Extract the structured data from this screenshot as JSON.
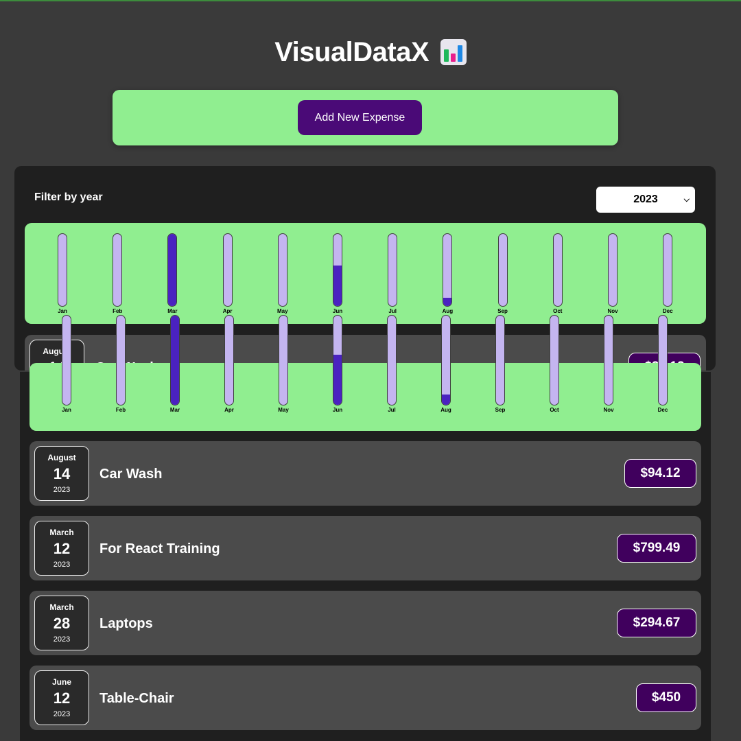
{
  "app": {
    "title": "VisualDataX"
  },
  "new_expense": {
    "add_label": "Add New Expense"
  },
  "filter": {
    "label": "Filter by year",
    "selected_year": "2023"
  },
  "chart_data": {
    "type": "bar",
    "categories": [
      "Jan",
      "Feb",
      "Mar",
      "Apr",
      "May",
      "Jun",
      "Jul",
      "Aug",
      "Sep",
      "Oct",
      "Nov",
      "Dec"
    ],
    "values": [
      0,
      0,
      799.49,
      0,
      0,
      450,
      0,
      94.12,
      0,
      0,
      0,
      0
    ],
    "ylim": [
      0,
      799.49
    ]
  },
  "expenses": [
    {
      "month": "August",
      "day": "14",
      "year": "2023",
      "title": "Car Wash",
      "amount": "$94.12"
    },
    {
      "month": "March",
      "day": "12",
      "year": "2023",
      "title": "For React Training",
      "amount": "$799.49"
    },
    {
      "month": "March",
      "day": "28",
      "year": "2023",
      "title": "Laptops",
      "amount": "$294.67"
    },
    {
      "month": "June",
      "day": "12",
      "year": "2023",
      "title": "Table-Chair",
      "amount": "$450"
    }
  ],
  "colors": {
    "page_bg": "#3a3a3a",
    "card_bg": "#1f1f1f",
    "chart_bg": "#90ee90",
    "bar_track": "#c4b5f0",
    "bar_fill": "#4a22c0",
    "button_bg": "#4a0a77",
    "price_bg": "#40005d"
  }
}
